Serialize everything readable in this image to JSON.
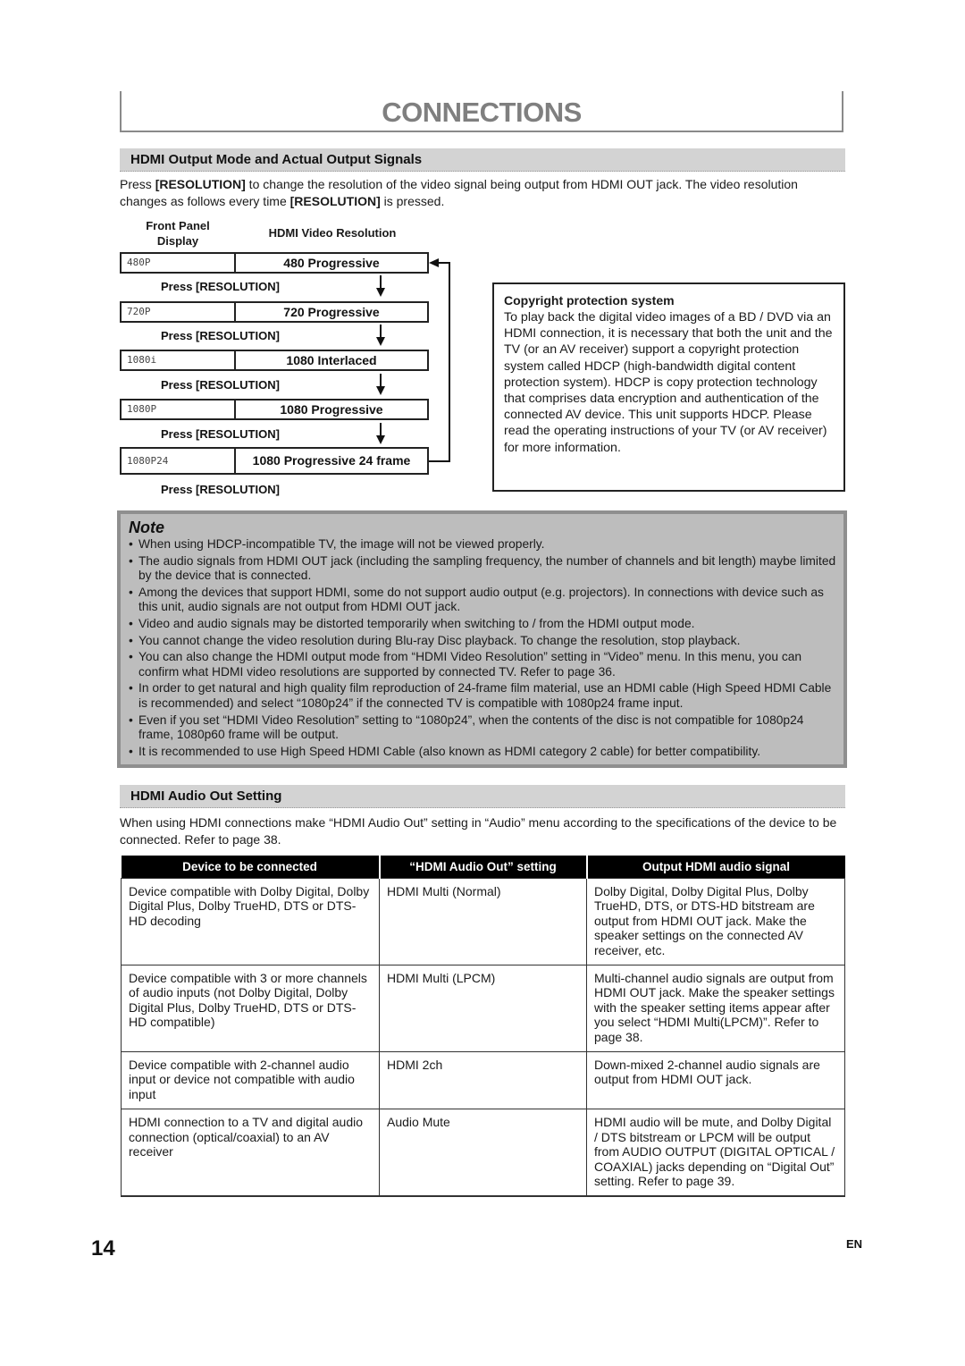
{
  "page": {
    "title": "CONNECTIONS",
    "page_number": "14",
    "language": "EN"
  },
  "section1": {
    "heading": "HDMI Output Mode and Actual Output Signals",
    "intro": {
      "p1": "Press ",
      "k1": "[RESOLUTION]",
      "p2": " to change the resolution of the video signal being output from HDMI OUT jack. The video resolution changes as follows every time ",
      "k2": "[RESOLUTION]",
      "p3": " is pressed."
    },
    "diagram": {
      "col_front_panel": "Front Panel Display",
      "col_front_panel_l1": "Front Panel",
      "col_front_panel_l2": "Display",
      "col_resolution": "HDMI Video Resolution",
      "press_label": "Press [RESOLUTION]",
      "rows": [
        {
          "display": "480P",
          "resolution": "480 Progressive"
        },
        {
          "display": "720P",
          "resolution": "720 Progressive"
        },
        {
          "display": "1080i",
          "resolution": "1080 Interlaced"
        },
        {
          "display": "1080P",
          "resolution": "1080 Progressive"
        },
        {
          "display": "1080P24",
          "resolution": "1080 Progressive 24 frame"
        }
      ]
    },
    "copyright": {
      "heading": "Copyright protection system",
      "body": "To play back the digital video images of a BD / DVD via an HDMI connection, it is necessary that both the unit and the TV (or an AV receiver) support a copyright protection system called HDCP (high-bandwidth digital content protection system). HDCP is copy protection technology that comprises data encryption and authentication of the connected AV device. This unit supports HDCP. Please read the operating instructions of your TV (or AV receiver) for more information."
    }
  },
  "note": {
    "title": "Note",
    "items": [
      "When using HDCP-incompatible TV, the image will not be viewed properly.",
      "The audio signals from HDMI OUT jack (including the sampling frequency, the number of channels and bit length) maybe limited by the device that is connected.",
      "Among the devices that support HDMI, some do not support audio output (e.g. projectors). In connections with device such as this unit, audio signals are not output from HDMI OUT jack.",
      "Video and audio signals may be distorted temporarily when switching to / from the HDMI output mode.",
      "You cannot change the video resolution during Blu-ray Disc playback. To change the resolution, stop playback.",
      "You can also change the HDMI output mode from “HDMI Video Resolution” setting in “Video” menu. In this menu, you can confirm what HDMI video resolutions are supported by connected TV. Refer to page 36.",
      "In order to get natural and high quality film reproduction of 24-frame film material, use an HDMI cable (High Speed HDMI Cable is recommended) and select “1080p24” if the connected TV is compatible with 1080p24 frame input.",
      "Even if you set “HDMI Video Resolution” setting to “1080p24”, when the contents of the disc is not compatible for 1080p24 frame, 1080p60 frame will be output.",
      "It is recommended to use High Speed HDMI Cable (also known as HDMI category 2 cable) for better compatibility."
    ]
  },
  "section2": {
    "heading": "HDMI Audio Out Setting",
    "intro": "When using HDMI connections make “HDMI Audio Out” setting in “Audio” menu according to the specifications of the device to be connected. Refer to page 38.",
    "table": {
      "headers": [
        "Device to be connected",
        "“HDMI Audio Out” setting",
        "Output HDMI audio signal"
      ],
      "rows": [
        [
          "Device compatible with Dolby Digital, Dolby Digital Plus, Dolby TrueHD, DTS or DTS-HD decoding",
          "HDMI Multi (Normal)",
          "Dolby Digital, Dolby Digital Plus, Dolby TrueHD, DTS, or DTS-HD bitstream are output from HDMI OUT jack. Make the speaker settings on the connected AV receiver, etc."
        ],
        [
          "Device compatible with 3 or more channels of audio inputs (not Dolby Digital, Dolby Digital Plus, Dolby TrueHD, DTS or DTS-HD compatible)",
          "HDMI Multi (LPCM)",
          "Multi-channel audio signals are output from HDMI OUT jack. Make the speaker settings with the speaker setting items appear after you select “HDMI Multi(LPCM)”. Refer to page 38."
        ],
        [
          "Device compatible with 2-channel audio input or device not compatible with audio input",
          "HDMI 2ch",
          "Down-mixed 2-channel audio signals are output from HDMI OUT jack."
        ],
        [
          "HDMI connection to a TV and digital audio connection (optical/coaxial) to an AV receiver",
          "Audio Mute",
          "HDMI audio will be mute, and Dolby Digital / DTS bitstream or LPCM will be output from AUDIO OUTPUT (DIGITAL OPTICAL / COAXIAL) jacks depending on “Digital Out” setting. Refer to page 39."
        ]
      ]
    }
  }
}
